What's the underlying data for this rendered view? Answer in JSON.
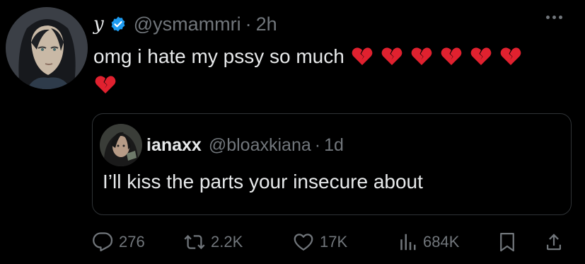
{
  "tweet": {
    "display_name": "y",
    "handle": "@ysmammri",
    "time": "2h",
    "text": "omg i hate my pssy so much",
    "broken_heart_count": 7
  },
  "quoted": {
    "display_name": "ianaxx",
    "handle": "@bloaxkiana",
    "time": "1d",
    "text": "I’ll kiss the parts your insecure about"
  },
  "actions": {
    "replies": "276",
    "reposts": "2.2K",
    "likes": "17K",
    "views": "684K"
  },
  "icons": {
    "verified": "verified-badge-icon",
    "more": "more-icon",
    "reply": "reply-icon",
    "repost": "repost-icon",
    "like": "like-icon",
    "views": "views-icon",
    "bookmark": "bookmark-icon",
    "share": "share-icon",
    "heart_emoji": "broken-heart-icon"
  },
  "colors": {
    "background": "#000000",
    "text": "#e7e9ea",
    "muted": "#71767b",
    "verified_blue": "#1d9bf0",
    "border": "#2f3336",
    "broken_heart": "#e0212f"
  }
}
